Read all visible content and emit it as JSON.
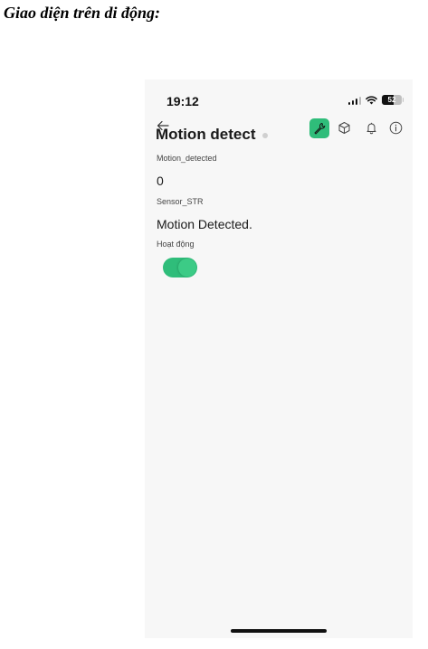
{
  "document": {
    "heading": "Giao diện trên di động:"
  },
  "status_bar": {
    "time": "19:12",
    "battery_level": "52",
    "icons": [
      "signal-icon",
      "wifi-icon",
      "battery-icon"
    ]
  },
  "app_bar": {
    "icons": [
      "back-arrow-icon",
      "wrench-icon",
      "box-icon",
      "bell-icon",
      "info-icon"
    ]
  },
  "page": {
    "title": "Motion detect"
  },
  "fields": [
    {
      "label": "Motion_detected",
      "value": "0"
    },
    {
      "label": "Sensor_STR",
      "value": "Motion Detected."
    }
  ],
  "toggle": {
    "label": "Hoạt động",
    "on": true
  },
  "colors": {
    "accent": "#2fbd7a",
    "background": "#f7f7f7",
    "status_dot": "#d0d0d0"
  }
}
